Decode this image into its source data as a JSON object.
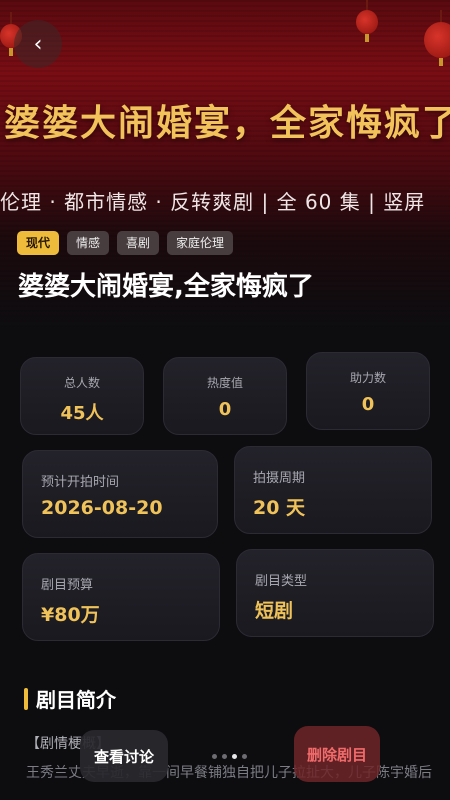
{
  "poster": {
    "title": "婆婆大闹婚宴，全家悔疯了",
    "subtitle": "伦理 · 都市情感 · 反转爽剧 | 全 60 集 | 竖屏"
  },
  "nav": {
    "back_icon": "chevron-left-icon"
  },
  "tags": [
    "现代",
    "情感",
    "喜剧",
    "家庭伦理"
  ],
  "title": "婆婆大闹婚宴,全家悔疯了",
  "stats": [
    {
      "label": "总人数",
      "value": "45人"
    },
    {
      "label": "热度值",
      "value": "0"
    },
    {
      "label": "助力数",
      "value": "0"
    }
  ],
  "info": [
    {
      "label": "预计开拍时间",
      "value": "2026-08-20"
    },
    {
      "label": "拍摄周期",
      "value": "20 天"
    },
    {
      "label": "剧目预算",
      "value": "¥80万"
    },
    {
      "label": "剧目类型",
      "value": "短剧"
    }
  ],
  "synopsis": {
    "heading": "剧目简介",
    "line1": "【剧情梗概】",
    "line2": "王秀兰丈夫早逝，靠一间早餐铺独自把儿子拉扯大，儿子陈宇婚后"
  },
  "actions": {
    "discuss": "查看讨论",
    "delete": "删除剧目"
  },
  "pager": {
    "total": 4,
    "active": 2
  },
  "colors": {
    "accent": "#eebc3a",
    "value": "#f0c35a",
    "danger": "#f26b6b"
  }
}
